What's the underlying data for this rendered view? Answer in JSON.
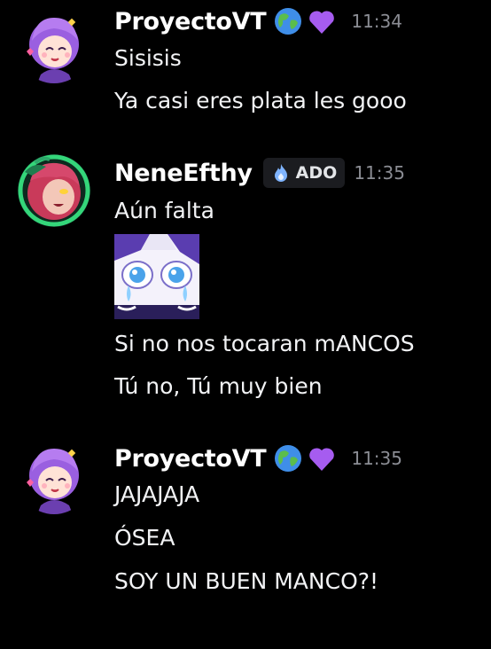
{
  "messages": [
    {
      "author": "ProyectoVT",
      "badges": [
        "globe-emoji",
        "purple-heart-emoji"
      ],
      "time": "11:34",
      "lines": [
        "Sisisis",
        "Ya casi eres plata les gooo"
      ]
    },
    {
      "author": "NeneEfthy",
      "tag": {
        "icon": "flame-icon",
        "label": "ADO"
      },
      "time": "11:35",
      "lines": [
        "Aún falta",
        "Si no nos tocaran mANCOS",
        "Tú no, Tú muy bien"
      ],
      "sticker": "crying-eyes-sticker"
    },
    {
      "author": "ProyectoVT",
      "badges": [
        "globe-emoji",
        "purple-heart-emoji"
      ],
      "time": "11:35",
      "lines": [
        "JAJAJAJA",
        "ÓSEA",
        "SOY UN BUEN MANCO?!"
      ]
    }
  ],
  "colors": {
    "background": "#000000",
    "text": "#f2f3f5",
    "timestamp": "#8b8d94",
    "tag_bg": "#1b1c20",
    "accent_purple": "#a65cf0"
  }
}
